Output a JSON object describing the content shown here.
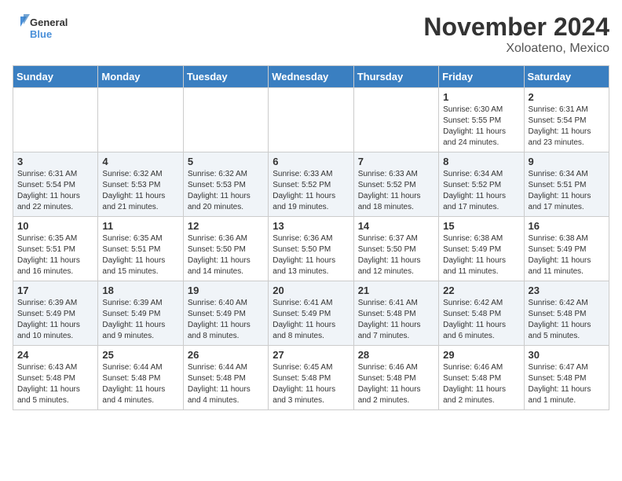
{
  "logo": {
    "general": "General",
    "blue": "Blue"
  },
  "title": "November 2024",
  "location": "Xoloateno, Mexico",
  "days_of_week": [
    "Sunday",
    "Monday",
    "Tuesday",
    "Wednesday",
    "Thursday",
    "Friday",
    "Saturday"
  ],
  "weeks": [
    [
      {
        "day": "",
        "info": ""
      },
      {
        "day": "",
        "info": ""
      },
      {
        "day": "",
        "info": ""
      },
      {
        "day": "",
        "info": ""
      },
      {
        "day": "",
        "info": ""
      },
      {
        "day": "1",
        "info": "Sunrise: 6:30 AM\nSunset: 5:55 PM\nDaylight: 11 hours and 24 minutes."
      },
      {
        "day": "2",
        "info": "Sunrise: 6:31 AM\nSunset: 5:54 PM\nDaylight: 11 hours and 23 minutes."
      }
    ],
    [
      {
        "day": "3",
        "info": "Sunrise: 6:31 AM\nSunset: 5:54 PM\nDaylight: 11 hours and 22 minutes."
      },
      {
        "day": "4",
        "info": "Sunrise: 6:32 AM\nSunset: 5:53 PM\nDaylight: 11 hours and 21 minutes."
      },
      {
        "day": "5",
        "info": "Sunrise: 6:32 AM\nSunset: 5:53 PM\nDaylight: 11 hours and 20 minutes."
      },
      {
        "day": "6",
        "info": "Sunrise: 6:33 AM\nSunset: 5:52 PM\nDaylight: 11 hours and 19 minutes."
      },
      {
        "day": "7",
        "info": "Sunrise: 6:33 AM\nSunset: 5:52 PM\nDaylight: 11 hours and 18 minutes."
      },
      {
        "day": "8",
        "info": "Sunrise: 6:34 AM\nSunset: 5:52 PM\nDaylight: 11 hours and 17 minutes."
      },
      {
        "day": "9",
        "info": "Sunrise: 6:34 AM\nSunset: 5:51 PM\nDaylight: 11 hours and 17 minutes."
      }
    ],
    [
      {
        "day": "10",
        "info": "Sunrise: 6:35 AM\nSunset: 5:51 PM\nDaylight: 11 hours and 16 minutes."
      },
      {
        "day": "11",
        "info": "Sunrise: 6:35 AM\nSunset: 5:51 PM\nDaylight: 11 hours and 15 minutes."
      },
      {
        "day": "12",
        "info": "Sunrise: 6:36 AM\nSunset: 5:50 PM\nDaylight: 11 hours and 14 minutes."
      },
      {
        "day": "13",
        "info": "Sunrise: 6:36 AM\nSunset: 5:50 PM\nDaylight: 11 hours and 13 minutes."
      },
      {
        "day": "14",
        "info": "Sunrise: 6:37 AM\nSunset: 5:50 PM\nDaylight: 11 hours and 12 minutes."
      },
      {
        "day": "15",
        "info": "Sunrise: 6:38 AM\nSunset: 5:49 PM\nDaylight: 11 hours and 11 minutes."
      },
      {
        "day": "16",
        "info": "Sunrise: 6:38 AM\nSunset: 5:49 PM\nDaylight: 11 hours and 11 minutes."
      }
    ],
    [
      {
        "day": "17",
        "info": "Sunrise: 6:39 AM\nSunset: 5:49 PM\nDaylight: 11 hours and 10 minutes."
      },
      {
        "day": "18",
        "info": "Sunrise: 6:39 AM\nSunset: 5:49 PM\nDaylight: 11 hours and 9 minutes."
      },
      {
        "day": "19",
        "info": "Sunrise: 6:40 AM\nSunset: 5:49 PM\nDaylight: 11 hours and 8 minutes."
      },
      {
        "day": "20",
        "info": "Sunrise: 6:41 AM\nSunset: 5:49 PM\nDaylight: 11 hours and 8 minutes."
      },
      {
        "day": "21",
        "info": "Sunrise: 6:41 AM\nSunset: 5:48 PM\nDaylight: 11 hours and 7 minutes."
      },
      {
        "day": "22",
        "info": "Sunrise: 6:42 AM\nSunset: 5:48 PM\nDaylight: 11 hours and 6 minutes."
      },
      {
        "day": "23",
        "info": "Sunrise: 6:42 AM\nSunset: 5:48 PM\nDaylight: 11 hours and 5 minutes."
      }
    ],
    [
      {
        "day": "24",
        "info": "Sunrise: 6:43 AM\nSunset: 5:48 PM\nDaylight: 11 hours and 5 minutes."
      },
      {
        "day": "25",
        "info": "Sunrise: 6:44 AM\nSunset: 5:48 PM\nDaylight: 11 hours and 4 minutes."
      },
      {
        "day": "26",
        "info": "Sunrise: 6:44 AM\nSunset: 5:48 PM\nDaylight: 11 hours and 4 minutes."
      },
      {
        "day": "27",
        "info": "Sunrise: 6:45 AM\nSunset: 5:48 PM\nDaylight: 11 hours and 3 minutes."
      },
      {
        "day": "28",
        "info": "Sunrise: 6:46 AM\nSunset: 5:48 PM\nDaylight: 11 hours and 2 minutes."
      },
      {
        "day": "29",
        "info": "Sunrise: 6:46 AM\nSunset: 5:48 PM\nDaylight: 11 hours and 2 minutes."
      },
      {
        "day": "30",
        "info": "Sunrise: 6:47 AM\nSunset: 5:48 PM\nDaylight: 11 hours and 1 minute."
      }
    ]
  ]
}
